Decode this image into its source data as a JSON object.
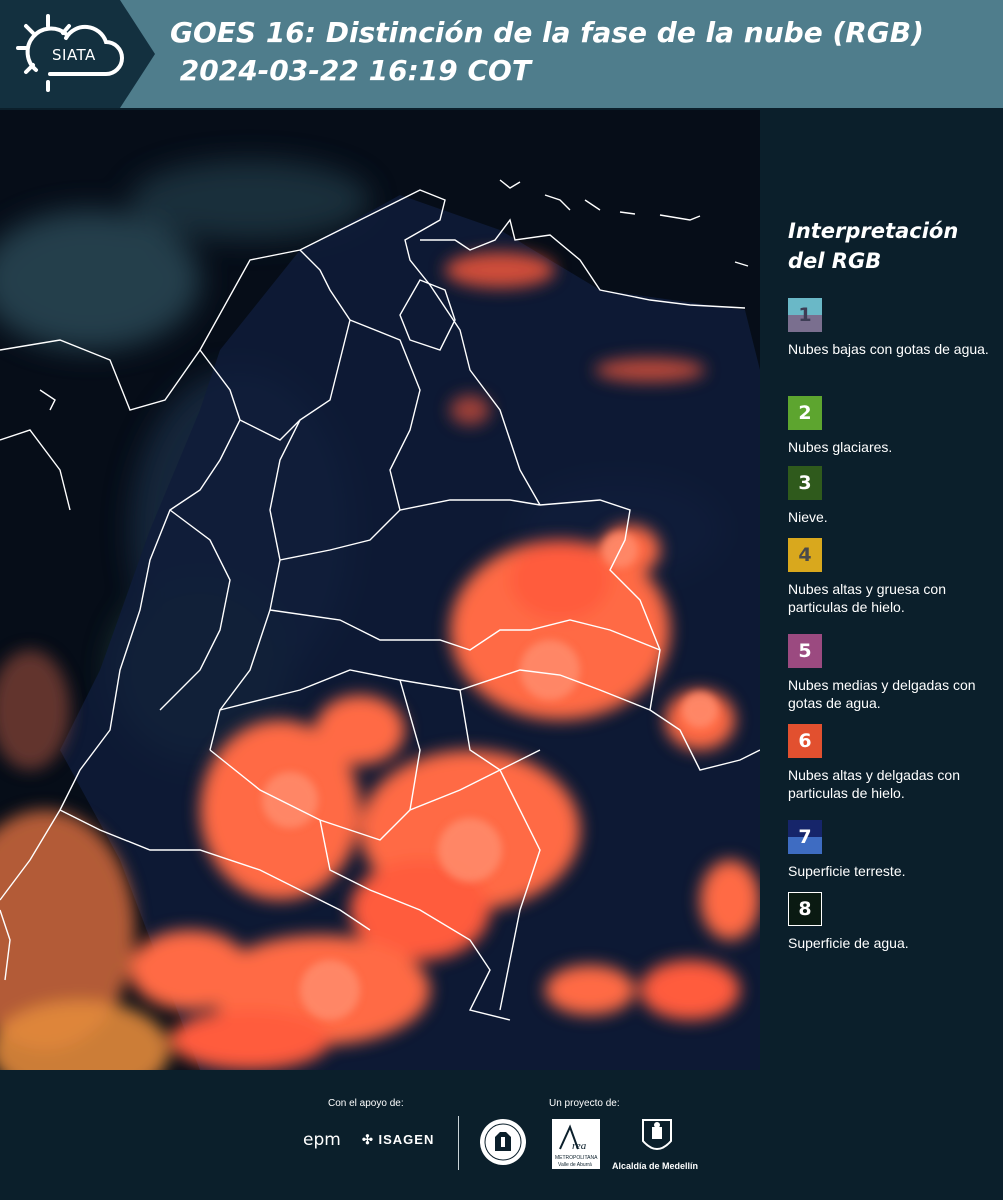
{
  "header": {
    "logo_text": "SIATA",
    "title": "GOES 16: Distinción de la fase de la nube (RGB)\n 2024-03-22 16:19 COT"
  },
  "map": {
    "background_color": "#060d18",
    "border_color": "#ffffff"
  },
  "legend": {
    "title": "Interpretación del RGB",
    "items": [
      {
        "number": "1",
        "label": "Nubes bajas con gotas de agua.",
        "color_top": "#6ab8c7",
        "color_bottom": "#7a6f8f"
      },
      {
        "number": "2",
        "label": "Nubes glaciares.",
        "color_top": "#5da52f",
        "color_bottom": "#5da52f"
      },
      {
        "number": "3",
        "label": "Nieve.",
        "color_top": "#2f5a1c",
        "color_bottom": "#2f5a1c"
      },
      {
        "number": "4",
        "label": "Nubes altas y gruesa con particulas de hielo.",
        "color_top": "#d9a81d",
        "color_bottom": "#d9a81d"
      },
      {
        "number": "5",
        "label": "Nubes medias y delgadas con gotas de agua.",
        "color_top": "#9b4a80",
        "color_bottom": "#9b4a80"
      },
      {
        "number": "6",
        "label": "Nubes altas y delgadas con particulas de hielo.",
        "color_top": "#e2502f",
        "color_bottom": "#e2502f"
      },
      {
        "number": "7",
        "label": "Superficie terreste.",
        "color_top": "#16256a",
        "color_bottom": "#3e6cc2"
      },
      {
        "number": "8",
        "label": "Superficie de agua.",
        "color_top": "#0a1a12",
        "color_bottom": "#0a1a12"
      }
    ]
  },
  "footer": {
    "support_label": "Con el apoyo de:",
    "project_label": "Un proyecto de:",
    "epm": "epm",
    "isagen": "ISAGEN",
    "area_logo_lines": [
      "Área",
      "METROPOLITANA",
      "Valle de Aburrá"
    ],
    "medellin": "Alcaldía de Medellín"
  }
}
